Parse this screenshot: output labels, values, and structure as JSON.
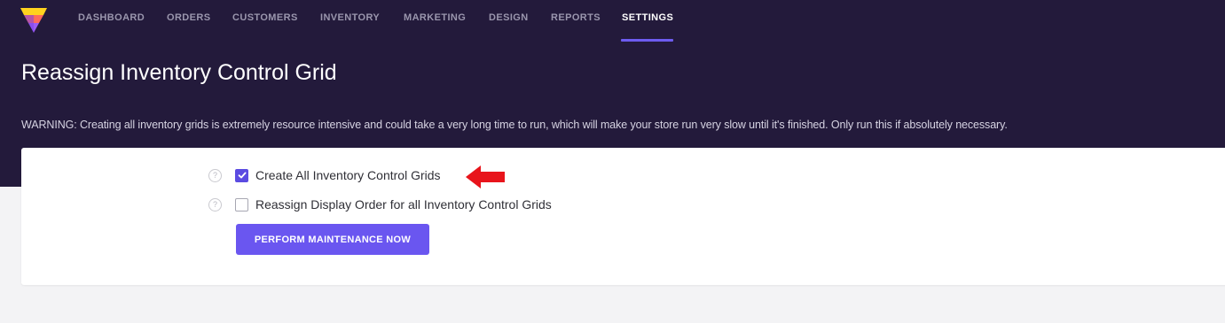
{
  "nav": {
    "items": [
      {
        "label": "DASHBOARD",
        "active": false
      },
      {
        "label": "ORDERS",
        "active": false
      },
      {
        "label": "CUSTOMERS",
        "active": false
      },
      {
        "label": "INVENTORY",
        "active": false
      },
      {
        "label": "MARKETING",
        "active": false
      },
      {
        "label": "DESIGN",
        "active": false
      },
      {
        "label": "REPORTS",
        "active": false
      },
      {
        "label": "SETTINGS",
        "active": true
      }
    ]
  },
  "page": {
    "title": "Reassign Inventory Control Grid",
    "warning": "WARNING: Creating all inventory grids is extremely resource intensive and could take a very long time to run, which will make your store run very slow until it's finished. Only run this if absolutely necessary."
  },
  "options": [
    {
      "label": "Create All Inventory Control Grids",
      "checked": true
    },
    {
      "label": "Reassign Display Order for all Inventory Control Grids",
      "checked": false
    }
  ],
  "actions": {
    "perform_label": "PERFORM MAINTENANCE NOW"
  },
  "colors": {
    "header_bg": "#231a3b",
    "accent": "#6a56f0",
    "annotation_arrow": "#e8141b"
  },
  "icons": {
    "logo": "brand-logo-icon",
    "help": "help-circle-icon",
    "check": "check-icon",
    "annotation": "arrow-left-icon"
  }
}
